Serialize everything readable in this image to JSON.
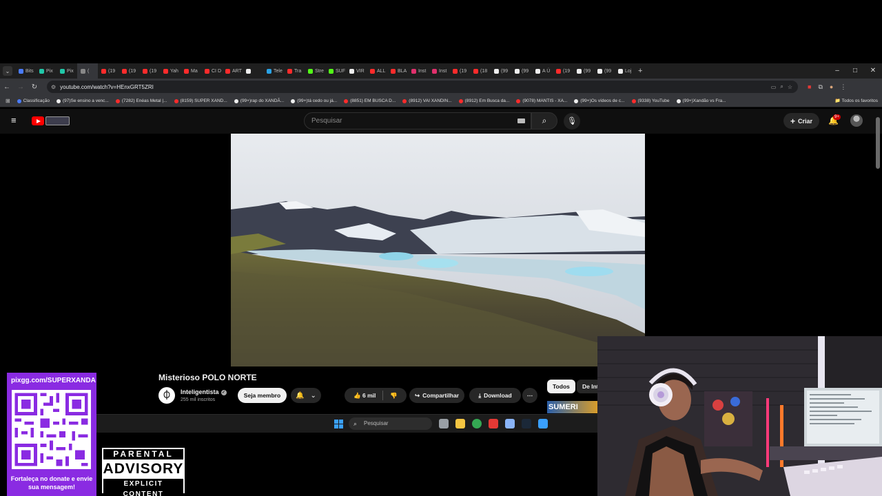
{
  "browser": {
    "tabs": [
      {
        "label": "Bits",
        "color": "#4a7cff"
      },
      {
        "label": "Pix",
        "color": "#21c7a8"
      },
      {
        "label": "Pix",
        "color": "#21c7a8"
      },
      {
        "label": "(",
        "color": "#888888"
      },
      {
        "label": "(19",
        "color": "#ff2b2b"
      },
      {
        "label": "(19",
        "color": "#ff2b2b"
      },
      {
        "label": "(19",
        "color": "#ff2b2b"
      },
      {
        "label": "Yah",
        "color": "#ff2b2b"
      },
      {
        "label": "Ma",
        "color": "#ff2b2b"
      },
      {
        "label": "CI D",
        "color": "#ff2b2b"
      },
      {
        "label": "ART",
        "color": "#ff2b2b"
      },
      {
        "label": "",
        "color": "#eeeeee"
      },
      {
        "label": "Tele",
        "color": "#2aa3e6"
      },
      {
        "label": "Tra",
        "color": "#ff2b2b"
      },
      {
        "label": "Stre",
        "color": "#53fc18"
      },
      {
        "label": "SUF",
        "color": "#53fc18"
      },
      {
        "label": "VIR",
        "color": "#eeeeee"
      },
      {
        "label": "ALL",
        "color": "#ff2b2b"
      },
      {
        "label": "BLA",
        "color": "#ff2b2b"
      },
      {
        "label": "Inst",
        "color": "#e1306c"
      },
      {
        "label": "Inst",
        "color": "#e1306c"
      },
      {
        "label": "(19",
        "color": "#ff2b2b"
      },
      {
        "label": "(18",
        "color": "#ff2b2b"
      },
      {
        "label": "(99",
        "color": "#eeeeee"
      },
      {
        "label": "(99",
        "color": "#eeeeee"
      },
      {
        "label": "A Ú",
        "color": "#eeeeee"
      },
      {
        "label": "(19",
        "color": "#ff2b2b"
      },
      {
        "label": "(99",
        "color": "#eeeeee"
      },
      {
        "label": "(99",
        "color": "#eeeeee"
      },
      {
        "label": "Loj",
        "color": "#eeeeee"
      }
    ],
    "new_tab": "+",
    "window_controls": {
      "minimize": "–",
      "maximize": "□",
      "close": "✕"
    },
    "url": "youtube.com/watch?v=HEnxGRT5ZRI",
    "bookmarks": [
      {
        "label": "Classificação",
        "color": "#4a7cff"
      },
      {
        "label": "(97)Se ensino a venc...",
        "color": "#eeeeee"
      },
      {
        "label": "(7282) Enéas Metal |...",
        "color": "#ff2b2b"
      },
      {
        "label": "(8159) SUPER XAND...",
        "color": "#ff2b2b"
      },
      {
        "label": "(99+)rap do XANDÃ...",
        "color": "#eeeeee"
      },
      {
        "label": "(99+)tá cedo ou já...",
        "color": "#eeeeee"
      },
      {
        "label": "(8851) EM BUSCA D...",
        "color": "#ff2b2b"
      },
      {
        "label": "(8912) VAI XANDIN...",
        "color": "#ff2b2b"
      },
      {
        "label": "(8912) Em Busca da...",
        "color": "#ff2b2b"
      },
      {
        "label": "(9078) MANTIS - XA...",
        "color": "#ff2b2b"
      },
      {
        "label": "(99+)Os vídeos de c...",
        "color": "#eeeeee"
      },
      {
        "label": "(9338) YouTube",
        "color": "#ff2b2b"
      },
      {
        "label": "(99+)Xandão vs Fra...",
        "color": "#eeeeee"
      }
    ],
    "bookmarks_folder": "Todos os favoritos"
  },
  "youtube": {
    "search_placeholder": "Pesquisar",
    "create_label": "Criar",
    "notif_badge": "9+",
    "video": {
      "title": "Misterioso POLO NORTE",
      "channel": "Inteligentista",
      "subscribers": "255 mil inscritos",
      "join_label": "Seja membro",
      "likes": "6 mil",
      "share_label": "Compartilhar",
      "download_label": "Download"
    },
    "chips": [
      "Todos",
      "De Int"
    ],
    "thumb_text": "SUMERI"
  },
  "taskbar": {
    "search_placeholder": "Pesquisar",
    "apps": [
      {
        "name": "task-view",
        "color": "#9aa0a6"
      },
      {
        "name": "file-explorer",
        "color": "#f4c542"
      },
      {
        "name": "chrome",
        "color": "#34a853"
      },
      {
        "name": "obs",
        "color": "#e53935"
      },
      {
        "name": "settings",
        "color": "#8ab4f8"
      },
      {
        "name": "steam",
        "color": "#1b2838"
      },
      {
        "name": "app",
        "color": "#3aa0ff"
      }
    ]
  },
  "overlay": {
    "donate_url": "pixgg.com/SUPERXANDA",
    "donate_message": "Fortaleça no donate e envie sua mensagem!",
    "advisory_top": "PARENTAL",
    "advisory_mid": "ADVISORY",
    "advisory_bottom": "EXPLICIT CONTENT"
  }
}
